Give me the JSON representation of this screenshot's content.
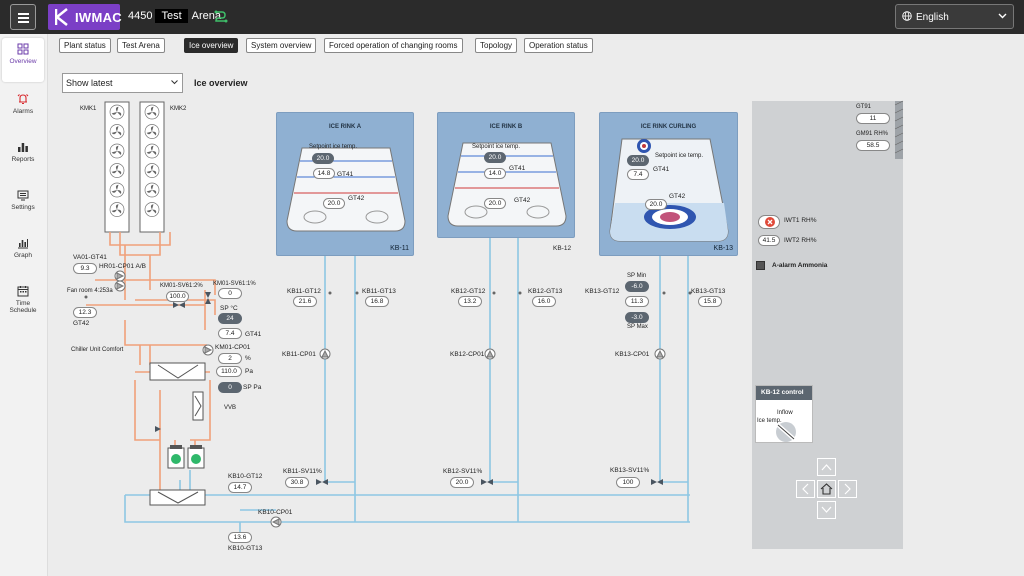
{
  "header": {
    "logo_text": "IWMAC",
    "site_number": "4450",
    "site_name_redacted": "Test",
    "site_suffix": "Arena",
    "language": "English"
  },
  "sidebar": {
    "items": [
      {
        "label": "Overview",
        "icon": "overview-icon"
      },
      {
        "label": "Alarms",
        "icon": "alarm-bell-icon"
      },
      {
        "label": "Reports",
        "icon": "bar-chart-icon"
      },
      {
        "label": "Settings",
        "icon": "settings-panel-icon"
      },
      {
        "label": "Graph",
        "icon": "graph-icon"
      },
      {
        "label": "Time",
        "label2": "Schedule",
        "icon": "calendar-icon"
      }
    ]
  },
  "tabs": [
    {
      "label": "Plant status"
    },
    {
      "label_redacted": "Test",
      "label_suffix": "Arena"
    },
    {
      "label": "Ice overview"
    },
    {
      "label": "System overview"
    },
    {
      "label": "Forced operation of changing rooms"
    },
    {
      "label": "Topology"
    },
    {
      "label": "Operation status"
    }
  ],
  "main": {
    "select_value": "Show latest",
    "title": "Ice overview"
  },
  "plant": {
    "kmk1": "KMK1",
    "kmk2": "KMK2",
    "va01_label": "VA01-GT41",
    "va01_value": "9.3",
    "hr01": "HR01-CP01 A/B",
    "fan_room": "Fan room 4:253a",
    "gt42_value": "12.3",
    "gt42_label": "GT42",
    "km01_sv61_2": "KM01-SV61:2%",
    "km01_sv61_2_value": "100.0",
    "km01_sv61_1": "KM01-SV61:1%",
    "km01_sv61_1_value": "0",
    "sp_c": "SP °C",
    "sp_c_value": "24",
    "gt41_value": "7.4",
    "gt41_label": "GT41",
    "km01_cp01": "KM01-CP01",
    "chiller": "Chiller Unit Comfort",
    "cp01_pct_value": "2",
    "cp01_pct_unit": "%",
    "pa_value": "110.0",
    "pa_unit": "Pa",
    "sp_pa_value": "0",
    "sp_pa_unit": "SP Pa",
    "vvb": "VVB",
    "kb10_gt12": "KB10-GT12",
    "kb10_gt12_value": "14.7",
    "kb10_cp01": "KB10-CP01",
    "kb10_gt13_value": "13.6",
    "kb10_gt13": "KB10-GT13"
  },
  "rinks": [
    {
      "title": "ICE RINK A",
      "kb": "KB-11",
      "setpoint_label": "Setpoint ice temp.",
      "setpoint": "20.0",
      "gt41": "14.8",
      "gt41_label": "GT41",
      "gt42": "20.0",
      "gt42_label": "GT42",
      "gt12_label": "KB11-GT12",
      "gt12": "21.6",
      "gt13_label": "KB11-GT13",
      "gt13": "16.8",
      "cp01": "KB11-CP01",
      "sv11_label": "KB11-SV11%",
      "sv11": "30.8"
    },
    {
      "title": "ICE RINK B",
      "kb": "KB-12",
      "setpoint_label": "Setpoint ice temp.",
      "setpoint": "20.0",
      "gt41": "14.0",
      "gt41_label": "GT41",
      "gt42": "20.0",
      "gt42_label": "GT42",
      "gt12_label": "KB12-GT12",
      "gt12": "13.2",
      "gt13_label": "KB12-GT13",
      "gt13": "16.0",
      "cp01": "KB12-CP01",
      "sv11_label": "KB12-SV11%",
      "sv11": "20.0"
    },
    {
      "title": "ICE RINK CURLING",
      "kb": "KB-13",
      "setpoint_label": "Setpoint ice temp.",
      "setpoint": "20.0",
      "gt41": "7.4",
      "gt41_label": "GT41",
      "gt42": "20.0",
      "gt42_label": "GT42",
      "gt12_label": "KB13-GT12",
      "gt12": "11.3",
      "gt13_label": "KB13-GT13",
      "gt13": "15.8",
      "sp_min_label": "SP Min",
      "sp_min": "-6.0",
      "sp_max_label": "SP Max",
      "sp_max": "-3.0",
      "cp01": "KB13-CP01",
      "sv11_label": "KB13-SV11%",
      "sv11": "100"
    }
  ],
  "outdoor": {
    "gt91_label": "GT91",
    "gt91": "11",
    "gm91_label": "GM91 RH%",
    "gm91": "58.5",
    "iwt1_label": "IWT1 RH%",
    "iwt2_label": "IWT2 RH%",
    "iwt2": "41.5",
    "alarm_label": "A-alarm Ammonia"
  },
  "control": {
    "title": "KB-12 control",
    "inflow": "Inflow",
    "ice_temp": "Ice temp."
  },
  "colors": {
    "accent": "#7b3fc6",
    "hot_pipe": "#f0a07a",
    "cold_pipe": "#8dc7e3",
    "rink_panel": "#8fb0d2",
    "status_dark": "#5c6670"
  }
}
